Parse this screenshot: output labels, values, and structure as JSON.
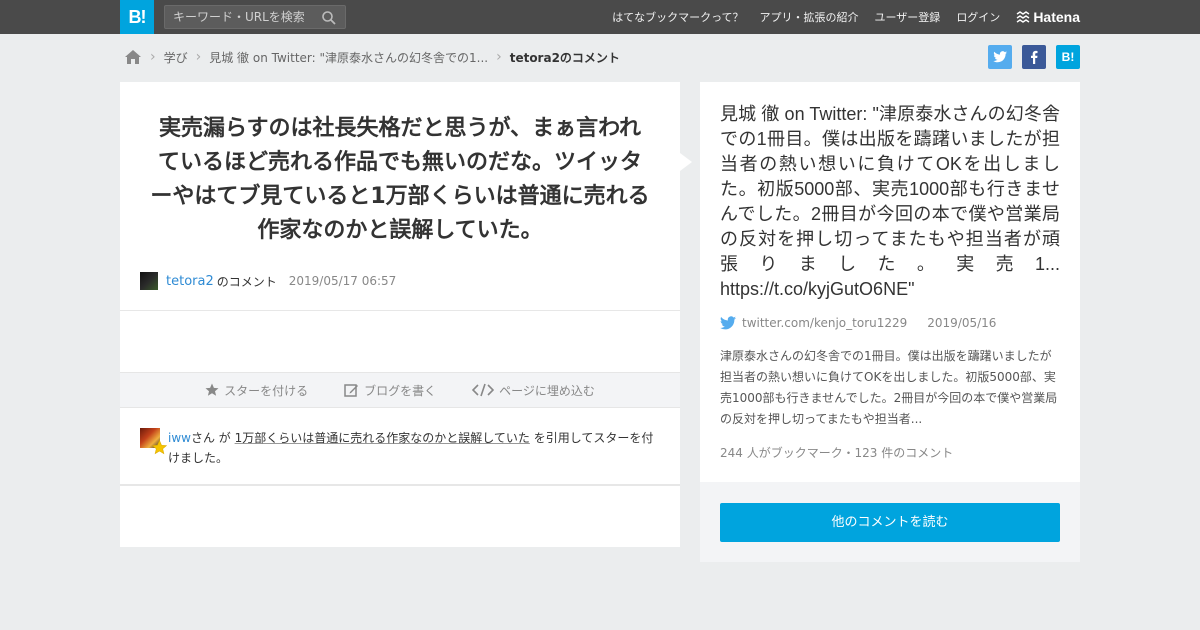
{
  "header": {
    "logo": "B!",
    "search_placeholder": "キーワード・URLを検索",
    "nav": [
      "はてなブックマークって？",
      "アプリ・拡張の紹介",
      "ユーザー登録",
      "ログイン"
    ],
    "brand": "Hatena"
  },
  "breadcrumb": {
    "items": [
      "学び",
      "見城 徹 on Twitter: \"津原泰水さんの幻冬舎での1..."
    ],
    "current": "tetora2のコメント"
  },
  "share": {
    "twitter": "t",
    "facebook": "f",
    "hatena": "B!"
  },
  "comment": {
    "text": "実売漏らすのは社長失格だと思うが、まぁ言われているほど売れる作品でも無いのだな。ツイッターやはてブ見ていると1万部くらいは普通に売れる作家なのかと誤解していた。",
    "user": "tetora2",
    "user_suffix": "のコメント",
    "date": "2019/05/17 06:57"
  },
  "actions": {
    "star": "スターを付ける",
    "blog": "ブログを書く",
    "embed": "ページに埋め込む"
  },
  "star_entry": {
    "user": "iww",
    "text1": "さん が ",
    "quote": "1万部くらいは普通に売れる作家なのかと誤解していた",
    "text2": " を引用してスターを付けました。"
  },
  "entry": {
    "title": "見城 徹 on Twitter: \"津原泰水さんの幻冬舎での1冊目。僕は出版を躊躇いましたが担当者の熱い想いに負けてOKを出しました。初版5000部、実売1000部も行きませんでした。2冊目が今回の本で僕や営業局の反対を押し切ってまたもや担当者が頑張りました。実売1... https://t.co/kyjGutO6NE\"",
    "source": "twitter.com/kenjo_toru1229",
    "date": "2019/05/16",
    "summary": "津原泰水さんの幻冬舎での1冊目。僕は出版を躊躇いましたが担当者の熱い想いに負けてOKを出しました。初版5000部、実売1000部も行きませんでした。2冊目が今回の本で僕や営業局の反対を押し切ってまたもや担当者...",
    "count": "244 人がブックマーク・123 件のコメント",
    "read_button": "他のコメントを読む"
  }
}
